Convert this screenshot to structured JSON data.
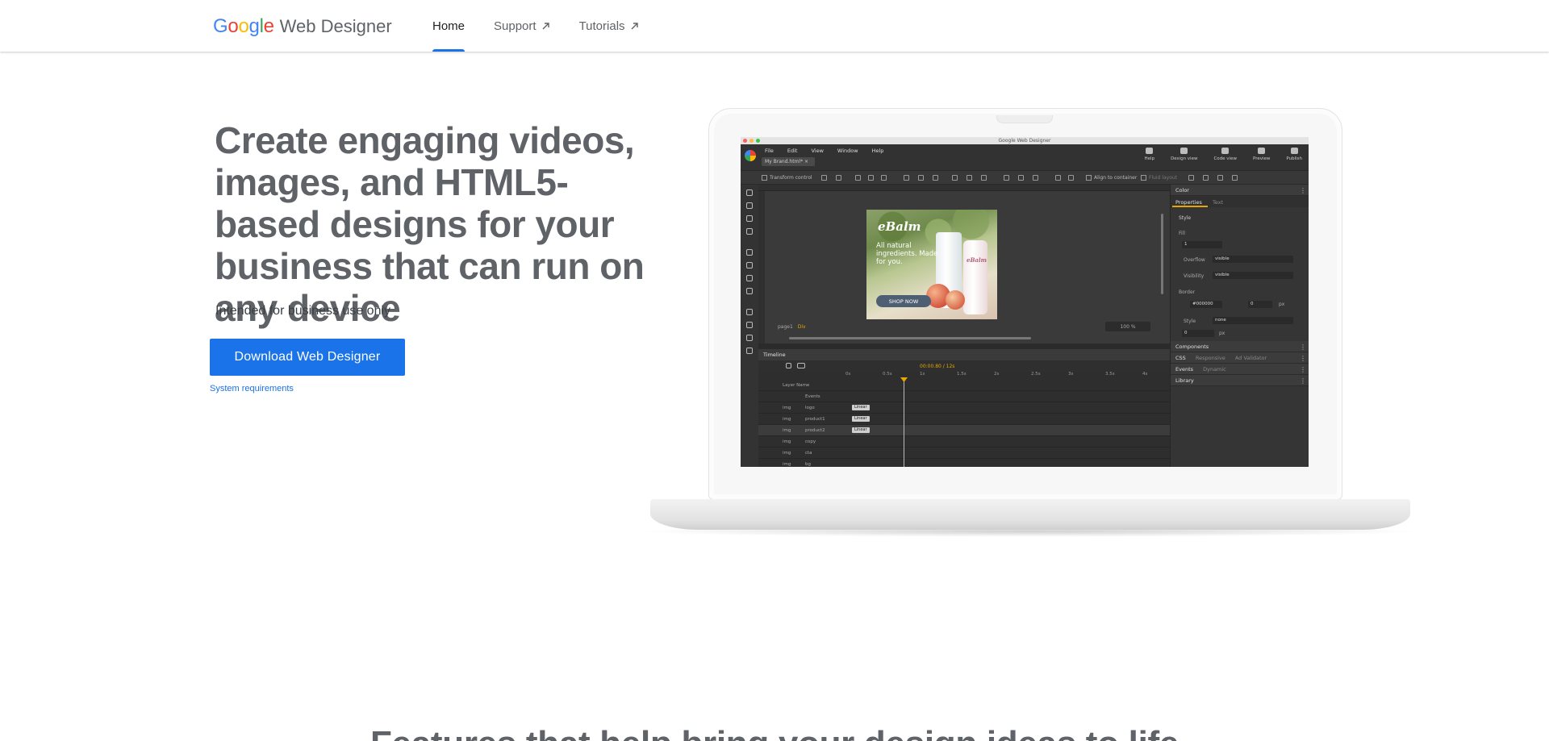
{
  "header": {
    "logo_google": "Google",
    "logo_product": "Web Designer",
    "nav": [
      {
        "label": "Home",
        "active": true
      },
      {
        "label": "Support",
        "external": true
      },
      {
        "label": "Tutorials",
        "external": true
      }
    ]
  },
  "hero": {
    "title": "Create engaging videos, images, and HTML5-based designs for your business that can run on any device",
    "note": "Intended for business use only",
    "download_label": "Download Web Designer",
    "sysreq_label": "System requirements"
  },
  "app_screenshot": {
    "window_title": "Google Web Designer",
    "menus": [
      "File",
      "Edit",
      "View",
      "Window",
      "Help"
    ],
    "doc_tab": "My Brand.html* ×",
    "right_tools": [
      "Help",
      "Design view",
      "Code view",
      "Preview",
      "Publish"
    ],
    "toolbar": {
      "transform": "Transform control",
      "align_container": "Align to container",
      "fluid_layout": "Fluid layout"
    },
    "page_selector": "page1",
    "page_element": "Div",
    "zoom": "100 %",
    "ad": {
      "brand": "eBalm",
      "copy": "All natural ingredients. Made for you.",
      "cta": "SHOP NOW",
      "bottle_label": "eBalm"
    },
    "panel": {
      "color": "Color",
      "tabs": [
        "Properties",
        "Text"
      ],
      "style": "Style",
      "fill": "Fill",
      "fill_value": "1",
      "overflow_label": "Overflow",
      "overflow_value": "visible",
      "visibility_label": "Visibility",
      "visibility_value": "visible",
      "border": "Border",
      "border_color": "#000000",
      "border_width": "0",
      "border_unit": "px",
      "border_style_label": "Style",
      "border_style_value": "none",
      "radius_value": "0",
      "radius_unit": "px",
      "components": "Components",
      "css": "CSS",
      "responsive": "Responsive",
      "ad_validator": "Ad Validator",
      "events": "Events",
      "dynamic": "Dynamic",
      "library": "Library"
    },
    "timeline": {
      "title": "Timeline",
      "time": "00:00.80 / 12s",
      "ruler": [
        "0s",
        "0.5s",
        "1s",
        "1.5s",
        "2s",
        "2.5s",
        "3s",
        "3.5s",
        "4s"
      ],
      "layer_header": "Layer Name",
      "events_row": "Events",
      "rows": [
        {
          "type": "img",
          "name": "logo",
          "key": "Linear"
        },
        {
          "type": "img",
          "name": "product1",
          "key": "Linear"
        },
        {
          "type": "img",
          "name": "product2",
          "key": "Linear",
          "selected": true
        },
        {
          "type": "img",
          "name": "copy",
          "key": ""
        },
        {
          "type": "img",
          "name": "cta",
          "key": ""
        },
        {
          "type": "img",
          "name": "bg",
          "key": ""
        }
      ]
    }
  },
  "features_heading": "Features that help bring your design ideas to life",
  "colors": {
    "accent": "#1a73e8",
    "title_gray": "#5f6368",
    "google_blue": "#4285f4",
    "google_red": "#ea4335",
    "google_yellow": "#fbbc04",
    "google_green": "#34a853",
    "timeline_orange": "#e6a700"
  }
}
